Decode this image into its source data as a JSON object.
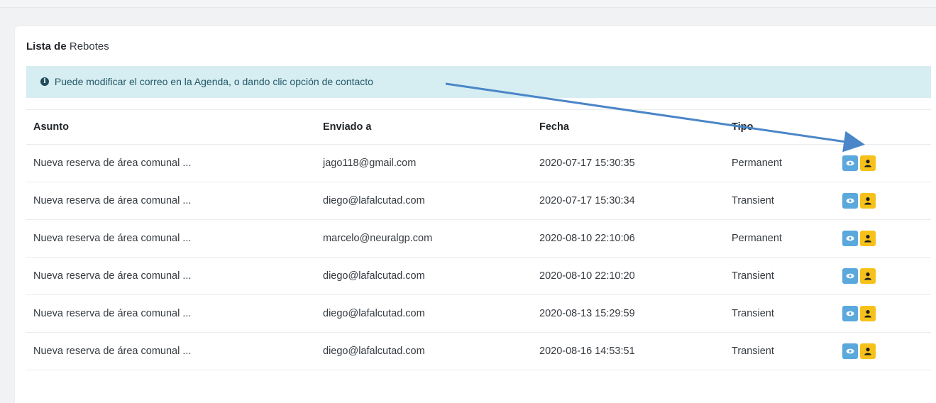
{
  "header": {
    "title_bold": "Lista de",
    "title_rest": "Rebotes"
  },
  "alert": {
    "text": "Puede modificar el correo en la Agenda, o dando clic opción de contacto",
    "icon": "info-circle-icon"
  },
  "table": {
    "columns": [
      "Asunto",
      "Enviado a",
      "Fecha",
      "Tipo",
      ""
    ],
    "rows": [
      {
        "asunto": "Nueva reserva de área comunal ...",
        "enviado": "jago118@gmail.com",
        "fecha": "2020-07-17 15:30:35",
        "tipo": "Permanent"
      },
      {
        "asunto": "Nueva reserva de área comunal ...",
        "enviado": "diego@lafalcutad.com",
        "fecha": "2020-07-17 15:30:34",
        "tipo": "Transient"
      },
      {
        "asunto": "Nueva reserva de área comunal ...",
        "enviado": "marcelo@neuralgp.com",
        "fecha": "2020-08-10 22:10:06",
        "tipo": "Permanent"
      },
      {
        "asunto": "Nueva reserva de área comunal ...",
        "enviado": "diego@lafalcutad.com",
        "fecha": "2020-08-10 22:10:20",
        "tipo": "Transient"
      },
      {
        "asunto": "Nueva reserva de área comunal ...",
        "enviado": "diego@lafalcutad.com",
        "fecha": "2020-08-13 15:29:59",
        "tipo": "Transient"
      },
      {
        "asunto": "Nueva reserva de área comunal ...",
        "enviado": "diego@lafalcutad.com",
        "fecha": "2020-08-16 14:53:51",
        "tipo": "Transient"
      }
    ],
    "actions": [
      {
        "name": "view-button",
        "icon": "eye-icon",
        "color": "#5aa8dc"
      },
      {
        "name": "contact-button",
        "icon": "user-icon",
        "color": "#f6c11b"
      }
    ]
  },
  "colors": {
    "alert_bg": "#d6edf2",
    "arrow": "#4a86c8"
  }
}
